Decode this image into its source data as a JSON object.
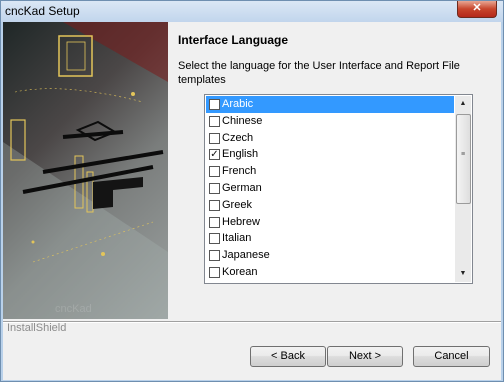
{
  "window": {
    "title": "cncKad Setup",
    "close_glyph": "✕"
  },
  "side_panel": {
    "brand": "InstallShield",
    "watermark": "cncKad"
  },
  "page": {
    "heading": "Interface Language",
    "description": "Select the language for the User Interface and Report File templates"
  },
  "languages": [
    {
      "label": "Arabic",
      "checked": false,
      "selected": true
    },
    {
      "label": "Chinese",
      "checked": false,
      "selected": false
    },
    {
      "label": "Czech",
      "checked": false,
      "selected": false
    },
    {
      "label": "English",
      "checked": true,
      "selected": false
    },
    {
      "label": "French",
      "checked": false,
      "selected": false
    },
    {
      "label": "German",
      "checked": false,
      "selected": false
    },
    {
      "label": "Greek",
      "checked": false,
      "selected": false
    },
    {
      "label": "Hebrew",
      "checked": false,
      "selected": false
    },
    {
      "label": "Italian",
      "checked": false,
      "selected": false
    },
    {
      "label": "Japanese",
      "checked": false,
      "selected": false
    },
    {
      "label": "Korean",
      "checked": false,
      "selected": false
    }
  ],
  "buttons": {
    "back": "< Back",
    "next": "Next >",
    "cancel": "Cancel"
  },
  "colors": {
    "selection": "#3399ff",
    "titlebar": "#c1d5ec",
    "close": "#c7452c"
  }
}
